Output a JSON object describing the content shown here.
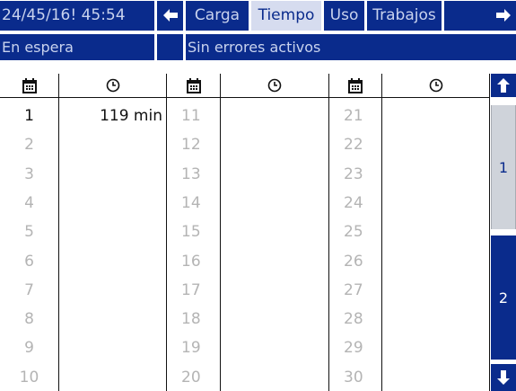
{
  "header": {
    "datetime": "24/45/16! 45:54",
    "tabs": [
      {
        "label": "Carga",
        "selected": false
      },
      {
        "label": "Tiempo",
        "selected": true
      },
      {
        "label": "Uso",
        "selected": false
      },
      {
        "label": "Trabajos",
        "selected": false
      }
    ]
  },
  "status": {
    "state": "En espera",
    "errors": "Sin errores activos"
  },
  "table": {
    "columns": [
      {
        "header_icon": "calendar-icon"
      },
      {
        "header_icon": "clock-icon"
      },
      {
        "header_icon": "calendar-icon"
      },
      {
        "header_icon": "clock-icon"
      },
      {
        "header_icon": "calendar-icon"
      },
      {
        "header_icon": "clock-icon"
      }
    ],
    "rows": [
      {
        "c1": "1",
        "v1": "119 min",
        "c2": "11",
        "v2": "",
        "c3": "21",
        "v3": ""
      },
      {
        "c1": "2",
        "v1": "",
        "c2": "12",
        "v2": "",
        "c3": "22",
        "v3": ""
      },
      {
        "c1": "3",
        "v1": "",
        "c2": "13",
        "v2": "",
        "c3": "23",
        "v3": ""
      },
      {
        "c1": "4",
        "v1": "",
        "c2": "14",
        "v2": "",
        "c3": "24",
        "v3": ""
      },
      {
        "c1": "5",
        "v1": "",
        "c2": "15",
        "v2": "",
        "c3": "25",
        "v3": ""
      },
      {
        "c1": "6",
        "v1": "",
        "c2": "16",
        "v2": "",
        "c3": "26",
        "v3": ""
      },
      {
        "c1": "7",
        "v1": "",
        "c2": "17",
        "v2": "",
        "c3": "27",
        "v3": ""
      },
      {
        "c1": "8",
        "v1": "",
        "c2": "18",
        "v2": "",
        "c3": "28",
        "v3": ""
      },
      {
        "c1": "9",
        "v1": "",
        "c2": "19",
        "v2": "",
        "c3": "29",
        "v3": ""
      },
      {
        "c1": "10",
        "v1": "",
        "c2": "20",
        "v2": "",
        "c3": "30",
        "v3": ""
      }
    ]
  },
  "pages": {
    "page1": "1",
    "page2": "2",
    "current_page": 1
  },
  "colors": {
    "bar_blue": "#0a2b8c",
    "bar_text": "#c9d3ee",
    "selected_tab": "#d6dcef",
    "inactive_text": "#b4b4b4"
  }
}
